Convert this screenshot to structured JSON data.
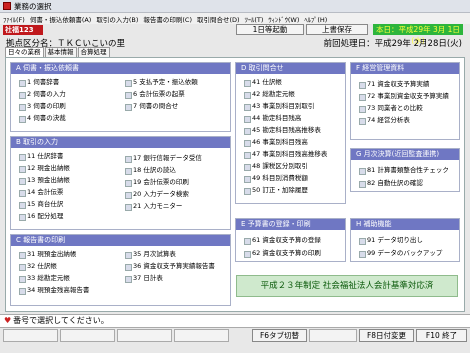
{
  "window": {
    "title": "業務の選択"
  },
  "menu": [
    "ﾌｧｲﾙ(F)",
    "伺書・振込依頼書(A)",
    "取引の入力(B)",
    "報告書の印刷(C)",
    "取引問合せ(D)",
    "ﾂｰﾙ(T)",
    "ｳｨﾝﾄﾞｳ(W)",
    "ﾍﾙﾌﾟ(H)"
  ],
  "header": {
    "logo": "社福123",
    "btn1": "1日等起動",
    "btn2": "上書保存",
    "date": "本日：平成29年 3月 1日(水)",
    "business": "拠点区分名：ＴＫＣいこいの里",
    "prev": "前回処理日：平成29年 2月28日(火)"
  },
  "tabs": [
    "日々の業務",
    "基本情報",
    "合算処理"
  ],
  "groups": {
    "A": {
      "title": "A 伺書・振込依頼書",
      "items": [
        "1 伺書辞書",
        "2 伺書の入力",
        "3 伺書の印刷",
        "4 伺書の決裁",
        "5 支払予定・振込依頼",
        "6 会計伝票の起票",
        "7 伺書の問合せ"
      ]
    },
    "B": {
      "title": "B 取引の入力",
      "items": [
        "11 仕訳辞書",
        "12 現金出納帳",
        "13 預金出納帳",
        "14 会計伝票",
        "15 商台仕訳",
        "16 配分処理",
        "17 銀行信報データ受信",
        "18 仕訳の読込",
        "19 会計伝票の印刷",
        "20 入力データ検索",
        "21 入力モニター"
      ]
    },
    "C": {
      "title": "C 報告書の印刷",
      "items": [
        "31 現預金出納帳",
        "32 仕訳帳",
        "33 総勘定元帳",
        "34 現預金残高報告書",
        "35 月次試算表",
        "36 資金収支予算実績報告書",
        "37 日計表"
      ]
    },
    "D": {
      "title": "D 取引問合せ",
      "items": [
        "41 仕訳帳",
        "42 総勘定元帳",
        "43 事業別科目別取引",
        "44 勘定科目残高",
        "45 勘定科目残高推移表",
        "46 事業別科目残高",
        "47 事業別科目残高推移表",
        "48 課税区分別取引",
        "49 科目別消費税額",
        "50 訂正・加除履歴"
      ]
    },
    "E": {
      "title": "E 予算書の登録・印刷",
      "items": [
        "61 資金収支予算の登録",
        "62 資金収支予算の印刷"
      ]
    },
    "F": {
      "title": "F 経営管理資料",
      "items": [
        "71 資金収支予算実績",
        "72 事業別資金収支予算実績",
        "73 同業者との比較",
        "74 経営分析表"
      ]
    },
    "G": {
      "title": "G 月次決算(近回監査連携)",
      "items": [
        "81 計算書類整合性チェック",
        "82 自動仕訳の確認"
      ]
    },
    "H": {
      "title": "H 補助機能",
      "items": [
        "91 データ切り出し",
        "99 データのバックアップ"
      ]
    }
  },
  "banner": "平成２３年制定 社会福祉法人会計基準対応済",
  "status": {
    "heart": "♥",
    "message": "番号で選択してください。"
  },
  "fkeys": {
    "f6": "F6タブ切替",
    "f8": "F8日付変更",
    "f10": "F10 終了"
  }
}
